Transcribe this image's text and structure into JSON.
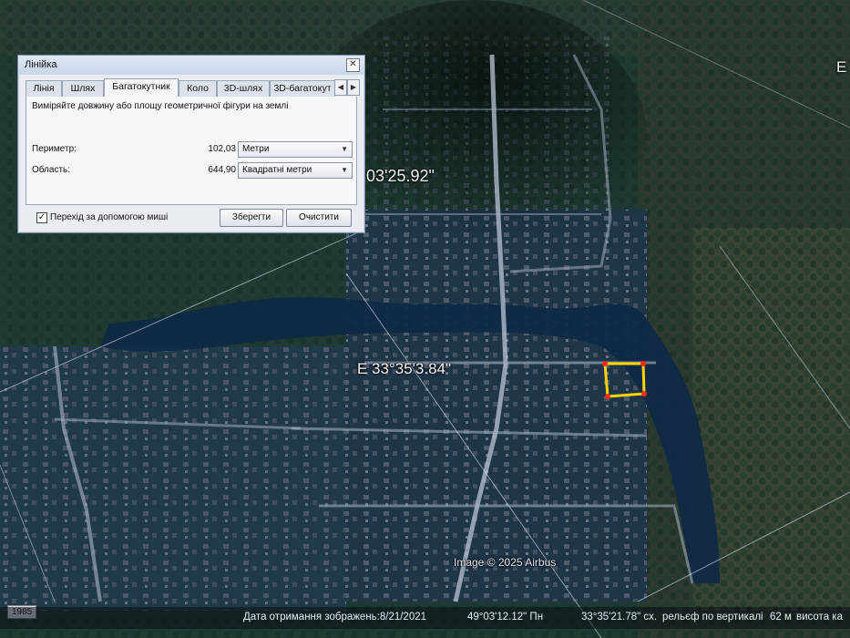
{
  "map": {
    "coord_north": "03'25.92\"",
    "coord_east": "E 33°35'3.84\"",
    "corner_letter": "E",
    "copyright": "Image © 2025 Airbus",
    "year_badge": "1985",
    "polygon_colors": {
      "outline": "#ffd400",
      "vertex": "#ff2a1a"
    }
  },
  "status_bar": {
    "date": "Дата отримання зображень:8/21/2021",
    "lat": "49°03'12.12\" Пн",
    "lon": "33°35'21.78\" сх.",
    "elevation_label": "рельєф по вертикалі",
    "elevation_value": "62 м",
    "altitude_label": "висота ка"
  },
  "dialog": {
    "title": "Лінійка",
    "close_icon": "close-icon",
    "tabs": [
      "Лінія",
      "Шлях",
      "Багатокутник",
      "Коло",
      "3D-шлях",
      "3D-багатокут"
    ],
    "active_tab": "Багатокутник",
    "description": "Виміряйте довжину або площу геометричної фігури на землі",
    "perimeter": {
      "label": "Периметр:",
      "value": "102,03",
      "unit": "Метри"
    },
    "area": {
      "label": "Область:",
      "value": "644,90",
      "unit": "Квадратні метри"
    },
    "mouse_nav": {
      "label": "Перехід за допомогою миші",
      "checked": true
    },
    "save_label": "Зберегти",
    "clear_label": "Очистити"
  }
}
